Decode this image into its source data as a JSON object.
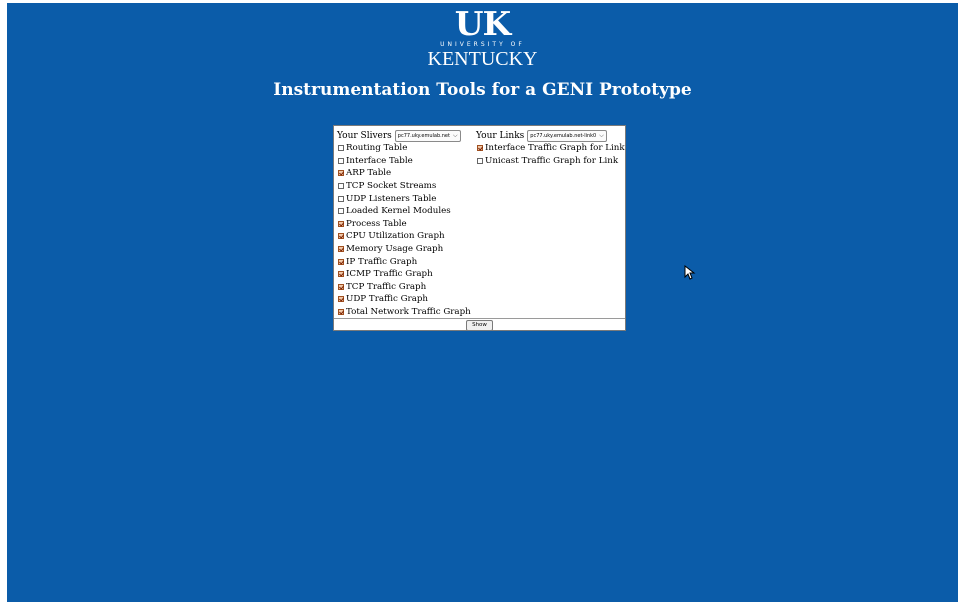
{
  "logo": {
    "uk": "UK",
    "university": "UNIVERSITY OF",
    "kentucky": "KENTUCKY"
  },
  "page_title": "Instrumentation Tools for a GENI Prototype",
  "slivers": {
    "label": "Your Slivers",
    "selected": "pc77.uky.emulab.net",
    "items": [
      {
        "label": "Routing Table",
        "checked": false
      },
      {
        "label": "Interface Table",
        "checked": false
      },
      {
        "label": "ARP Table",
        "checked": true
      },
      {
        "label": "TCP Socket Streams",
        "checked": false
      },
      {
        "label": "UDP Listeners Table",
        "checked": false
      },
      {
        "label": "Loaded Kernel Modules",
        "checked": false
      },
      {
        "label": "Process Table",
        "checked": true
      },
      {
        "label": "CPU Utilization Graph",
        "checked": true
      },
      {
        "label": "Memory Usage Graph",
        "checked": true
      },
      {
        "label": "IP Traffic Graph",
        "checked": true
      },
      {
        "label": "ICMP Traffic Graph",
        "checked": true
      },
      {
        "label": "TCP Traffic Graph",
        "checked": true
      },
      {
        "label": "UDP Traffic Graph",
        "checked": true
      },
      {
        "label": "Total Network Traffic Graph",
        "checked": true
      }
    ]
  },
  "links": {
    "label": "Your Links",
    "selected": "pc77.uky.emulab.net-link0",
    "items": [
      {
        "label": "Interface Traffic Graph for Link",
        "checked": true
      },
      {
        "label": "Unicast Traffic Graph for Link",
        "checked": false
      }
    ]
  },
  "show_label": "Show",
  "colors": {
    "background": "#0b5ca9",
    "checkbox_checked": "#f0c8a8"
  }
}
